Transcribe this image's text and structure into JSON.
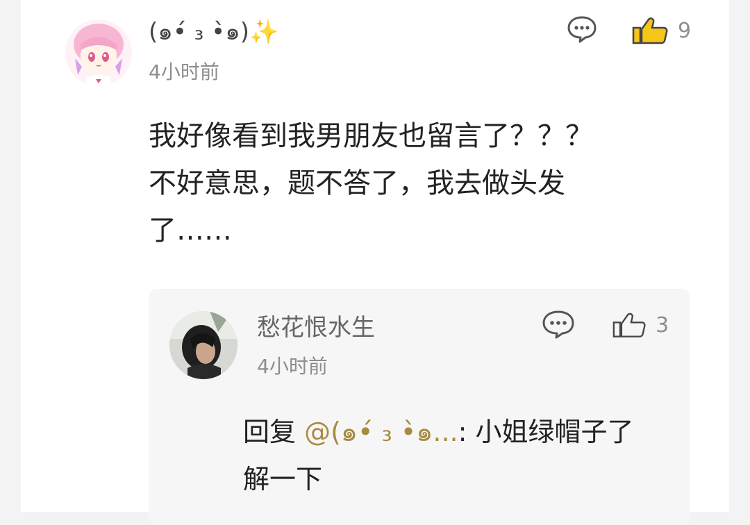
{
  "comment": {
    "user_name": "(๑•́ ₃ •̀๑)",
    "name_emoji": "✨",
    "time": "4小时前",
    "like_count": "9",
    "body": "我好像看到我男朋友也留言了？？？\n不好意思，题不答了，我去做头发\n了……",
    "avatar_icon": "avatar-anime-girl",
    "comment_icon": "comment-bubble-icon",
    "like_icon": "thumbs-up-icon",
    "like_color": "#f5c518"
  },
  "reply": {
    "user_name": "愁花恨水生",
    "time": "4小时前",
    "like_count": "3",
    "prefix": "回复 ",
    "mention": "@(๑•́ ₃ •̀๑...",
    "body": ": 小姐绿帽子了\n解一下",
    "avatar_icon": "avatar-photo",
    "comment_icon": "comment-bubble-icon",
    "like_icon": "thumbs-up-icon",
    "mention_color": "#a88a42"
  }
}
